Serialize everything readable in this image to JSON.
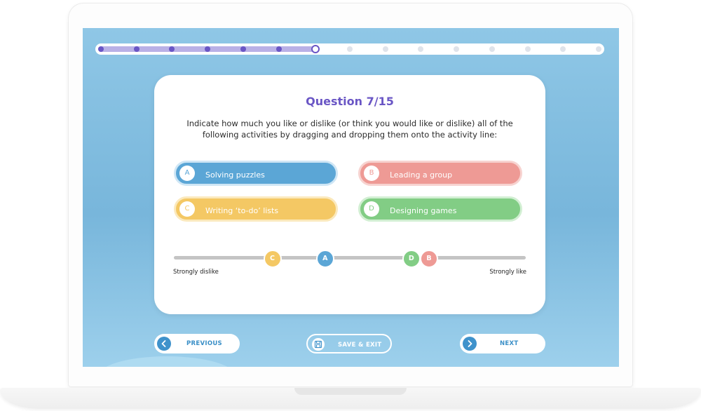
{
  "progress": {
    "current": 7,
    "total": 15
  },
  "question": {
    "title": "Question 7/15",
    "text": "Indicate how much you like or dislike (or think you would like or dislike) all of the following activities by dragging and dropping them onto the activity line:"
  },
  "options": [
    {
      "letter": "A",
      "label": "Solving puzzles",
      "color": "#5ba6d6",
      "border": "#cfe6f5",
      "letter_color": "#5ba6d6"
    },
    {
      "letter": "B",
      "label": "Leading a group",
      "color": "#ee9a95",
      "border": "#f7d3d0",
      "letter_color": "#ee9a95"
    },
    {
      "letter": "C",
      "label": "Writing ‘to-do’ lists",
      "color": "#f4c864",
      "border": "#fbe9bd",
      "letter_color": "#f4c864"
    },
    {
      "letter": "D",
      "label": "Designing games",
      "color": "#82cd85",
      "border": "#d2efd3",
      "letter_color": "#82cd85"
    }
  ],
  "scale": {
    "min_label": "Strongly dislike",
    "max_label": "Strongly like",
    "positions": {
      "C": 0.28,
      "A": 0.43,
      "D": 0.675,
      "B": 0.725
    }
  },
  "nav": {
    "previous": "PREVIOUS",
    "save_exit": "SAVE & EXIT",
    "next": "NEXT"
  },
  "icons": {
    "previous": "chevron-left-icon",
    "save": "save-icon",
    "next": "chevron-right-icon"
  }
}
